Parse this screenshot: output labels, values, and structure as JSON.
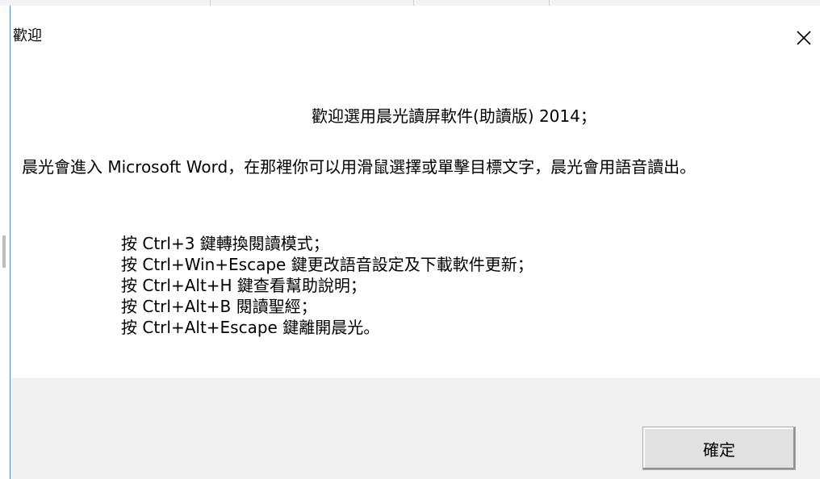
{
  "dialog": {
    "title": "歡迎",
    "close_icon": "close-icon",
    "welcome_line": "歡迎選用晨光讀屏軟件(助讀版) 2014；",
    "intro_paragraph": "晨光會進入 Microsoft Word，在那裡你可以用滑鼠選擇或單擊目標文字，晨光會用語音讀出。",
    "shortcuts": [
      "按 Ctrl+3 鍵轉換閱讀模式；",
      "按 Ctrl+Win+Escape 鍵更改語音設定及下載軟件更新；",
      "按 Ctrl+Alt+H 鍵查看幫助說明；",
      "按 Ctrl+Alt+B 閱讀聖經；",
      "按 Ctrl+Alt+Escape 鍵離開晨光。"
    ],
    "ok_button_label": "確定"
  },
  "colors": {
    "dialog_border": "#4a8fd6",
    "footer_background": "#f0f0f0",
    "button_face": "#e1e1e1"
  }
}
